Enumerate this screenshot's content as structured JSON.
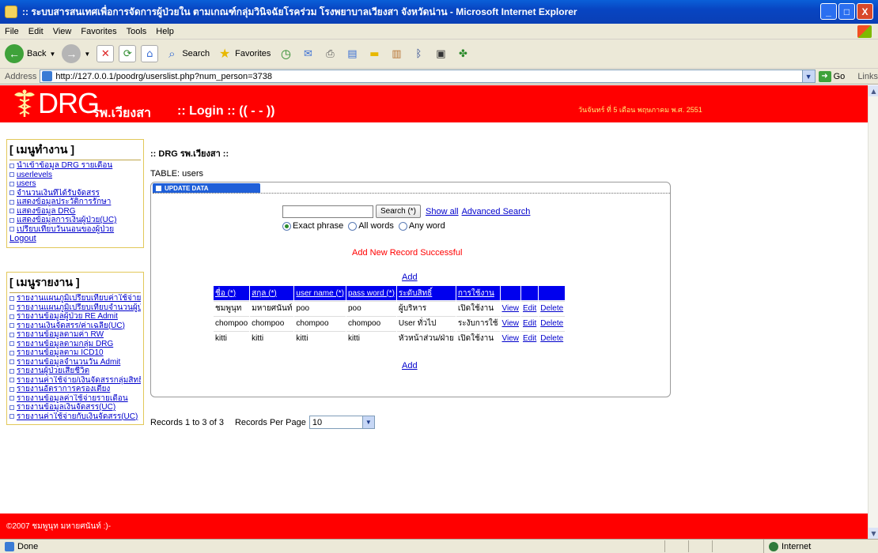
{
  "window": {
    "title": ":: ระบบสารสนเทศเพื่อการจัดการผู้ป่วยใน ตามเกณฑ์กลุ่มวินิจฉัยโรคร่วม โรงพยาบาลเวียงสา จังหวัดน่าน - Microsoft Internet Explorer",
    "controls": [
      "_",
      "□",
      "X"
    ]
  },
  "menubar": [
    "File",
    "Edit",
    "View",
    "Favorites",
    "Tools",
    "Help"
  ],
  "toolbar": {
    "back": "Back",
    "search": "Search",
    "favorites": "Favorites"
  },
  "address": {
    "label": "Address",
    "url": "http://127.0.0.1/poodrg/userslist.php?num_person=3738",
    "go": "Go",
    "links": "Links"
  },
  "banner": {
    "brand": "DRG",
    "brand_sub": "รพ.เวียงสา",
    "login": ":: Login :: (( - - ))",
    "date": "วันจันทร์ ที่ 5 เดือน พฤษภาคม พ.ศ. 2551"
  },
  "menu_work": {
    "title": "[ เมนูทำงาน ]",
    "items": [
      "นำเข้าข้อมูล DRG รายเดือน",
      "userlevels",
      "users",
      "จำนวนเงินที่ได้รับจัดสรร",
      "แสดงข้อมูลประวัติการรักษา",
      "แสดงข้อมูล DRG",
      "แสดงข้อมูลการเงินผู้ป่วย(UC)",
      "เปรียบเทียบวันนอนของผู้ป่วย"
    ],
    "logout": "Logout"
  },
  "menu_report": {
    "title": "[ เมนูรายงาน ]",
    "items": [
      "รายงานแผนภูมิเปรียบเทียบค่าใช้จ่าย",
      "รายงานแผนภูมิเปรียบเทียบจำนวนผู้ป่วย",
      "รายงานข้อมูลผู้ป่วย RE Admit",
      "รายงานเงินจัดสรร/ค่าเฉลี่ย(UC)",
      "รายงานข้อมูลตามค่า RW",
      "รายงานข้อมูลตามกลุ่ม DRG",
      "รายงานข้อมูลตาม ICD10",
      "รายงานข้อมูลจำนวนวัน Admit",
      "รายงานผู้ป่วยเสียชีวิต",
      "รายงานค่าใช้จ่าย/เงินจัดสรรกลุ่มสิทธิ",
      "รายงานอัตราการครองเตียง",
      "รายงานข้อมูลค่าใช้จ่ายรายเดือน",
      "รายงานข้อมูลเงินจัดสรร(UC)",
      "รายงานค่าใช้จ่ายกับเงินจัดสรร(UC)"
    ]
  },
  "main": {
    "breadcrumb": ":: DRG รพ.เวียงสา ::",
    "table_label": "TABLE: users",
    "update_tab": "UPDATE DATA",
    "search": {
      "value": "",
      "button": "Search (*)",
      "show_all": "Show all",
      "advanced": "Advanced Search"
    },
    "radios": [
      {
        "label": "Exact phrase",
        "checked": true
      },
      {
        "label": "All words",
        "checked": false
      },
      {
        "label": "Any word",
        "checked": false
      }
    ],
    "message": "Add New Record Successful",
    "add_label": "Add",
    "columns": [
      "ชื่อ (*)",
      "สกุล (*)",
      "user name (*)",
      "pass word (*)",
      "ระดับสิทธิ์",
      "การใช้งาน"
    ],
    "rows": [
      {
        "cells": [
          "ชมพูนุท",
          "มหายศนันท์",
          "poo",
          "poo",
          "ผู้บริหาร",
          "เปิดใช้งาน"
        ],
        "actions": [
          "View",
          "Edit",
          "Delete"
        ]
      },
      {
        "cells": [
          "chompoo",
          "chompoo",
          "chompoo",
          "chompoo",
          "User ทั่วไป",
          "ระงับการใช้"
        ],
        "actions": [
          "View",
          "Edit",
          "Delete"
        ]
      },
      {
        "cells": [
          "kitti",
          "kitti",
          "kitti",
          "kitti",
          "หัวหน้าส่วน/ฝ่าย",
          "เปิดใช้งาน"
        ],
        "actions": [
          "View",
          "Edit",
          "Delete"
        ]
      }
    ],
    "records_text": "Records 1 to 3 of 3",
    "records_per_page_label": "Records Per Page",
    "records_per_page_value": "10"
  },
  "footer": "©2007 ชมพูนุท มหายศนันท์ :)-",
  "statusbar": {
    "status": "Done",
    "zone": "Internet"
  },
  "colors": {
    "banner_red": "#ff0000",
    "header_blue": "#0000ee",
    "link_blue": "#0000cc",
    "message_red": "#ff0000",
    "date_yellow": "#ffef7a"
  }
}
